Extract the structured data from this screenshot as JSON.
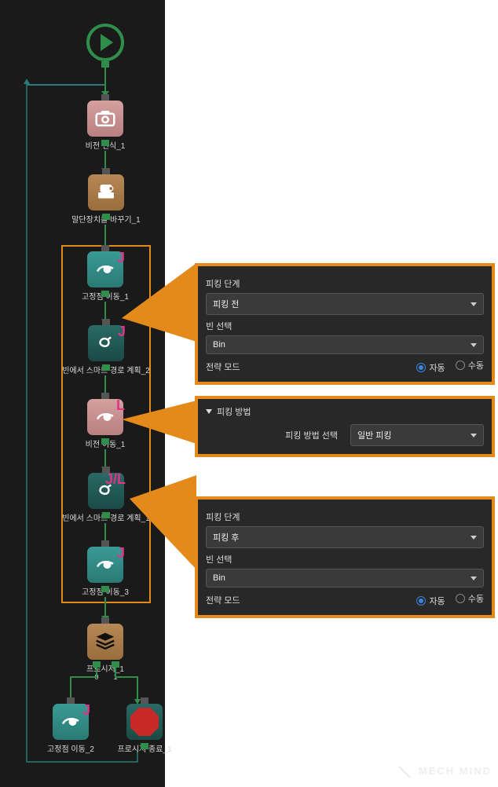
{
  "flow": {
    "start": "",
    "n1_label": "비전 인식_1",
    "n2_label": "말단장치를 바꾸기_1",
    "n3_label": "고정점 이동_1",
    "n4_label": "빈에서 스마트 경로 계획_2",
    "n5_label": "비전 이동_1",
    "n6_label": "빈에서 스마트 경로 계획_1",
    "n7_label": "고정점 이동_3",
    "n8_label": "프로시저_1",
    "n9_label": "고정점 이동_2",
    "n10_label": "프로시저 종료_1",
    "n3_badge": "J",
    "n4_badge": "J",
    "n5_badge": "L",
    "n6_badge": "J/L",
    "n7_badge": "J",
    "n9_badge": "J",
    "out0": "0",
    "out1": "1"
  },
  "panel1": {
    "label_stage": "피킹 단계",
    "stage_value": "피킹 전",
    "label_bin": "빈 선택",
    "bin_value": "Bin",
    "label_mode": "전략 모드",
    "mode_auto": "자동",
    "mode_manual": "수동",
    "mode_selected": "auto"
  },
  "panel2": {
    "header": "피킹 방법",
    "label_method": "피킹 방법 선택",
    "method_value": "일반 피킹"
  },
  "panel3": {
    "label_stage": "피킹 단계",
    "stage_value": "피킹 후",
    "label_bin": "빈 선택",
    "bin_value": "Bin",
    "label_mode": "전략 모드",
    "mode_auto": "자동",
    "mode_manual": "수동",
    "mode_selected": "auto"
  },
  "watermark": "MECH MIND"
}
